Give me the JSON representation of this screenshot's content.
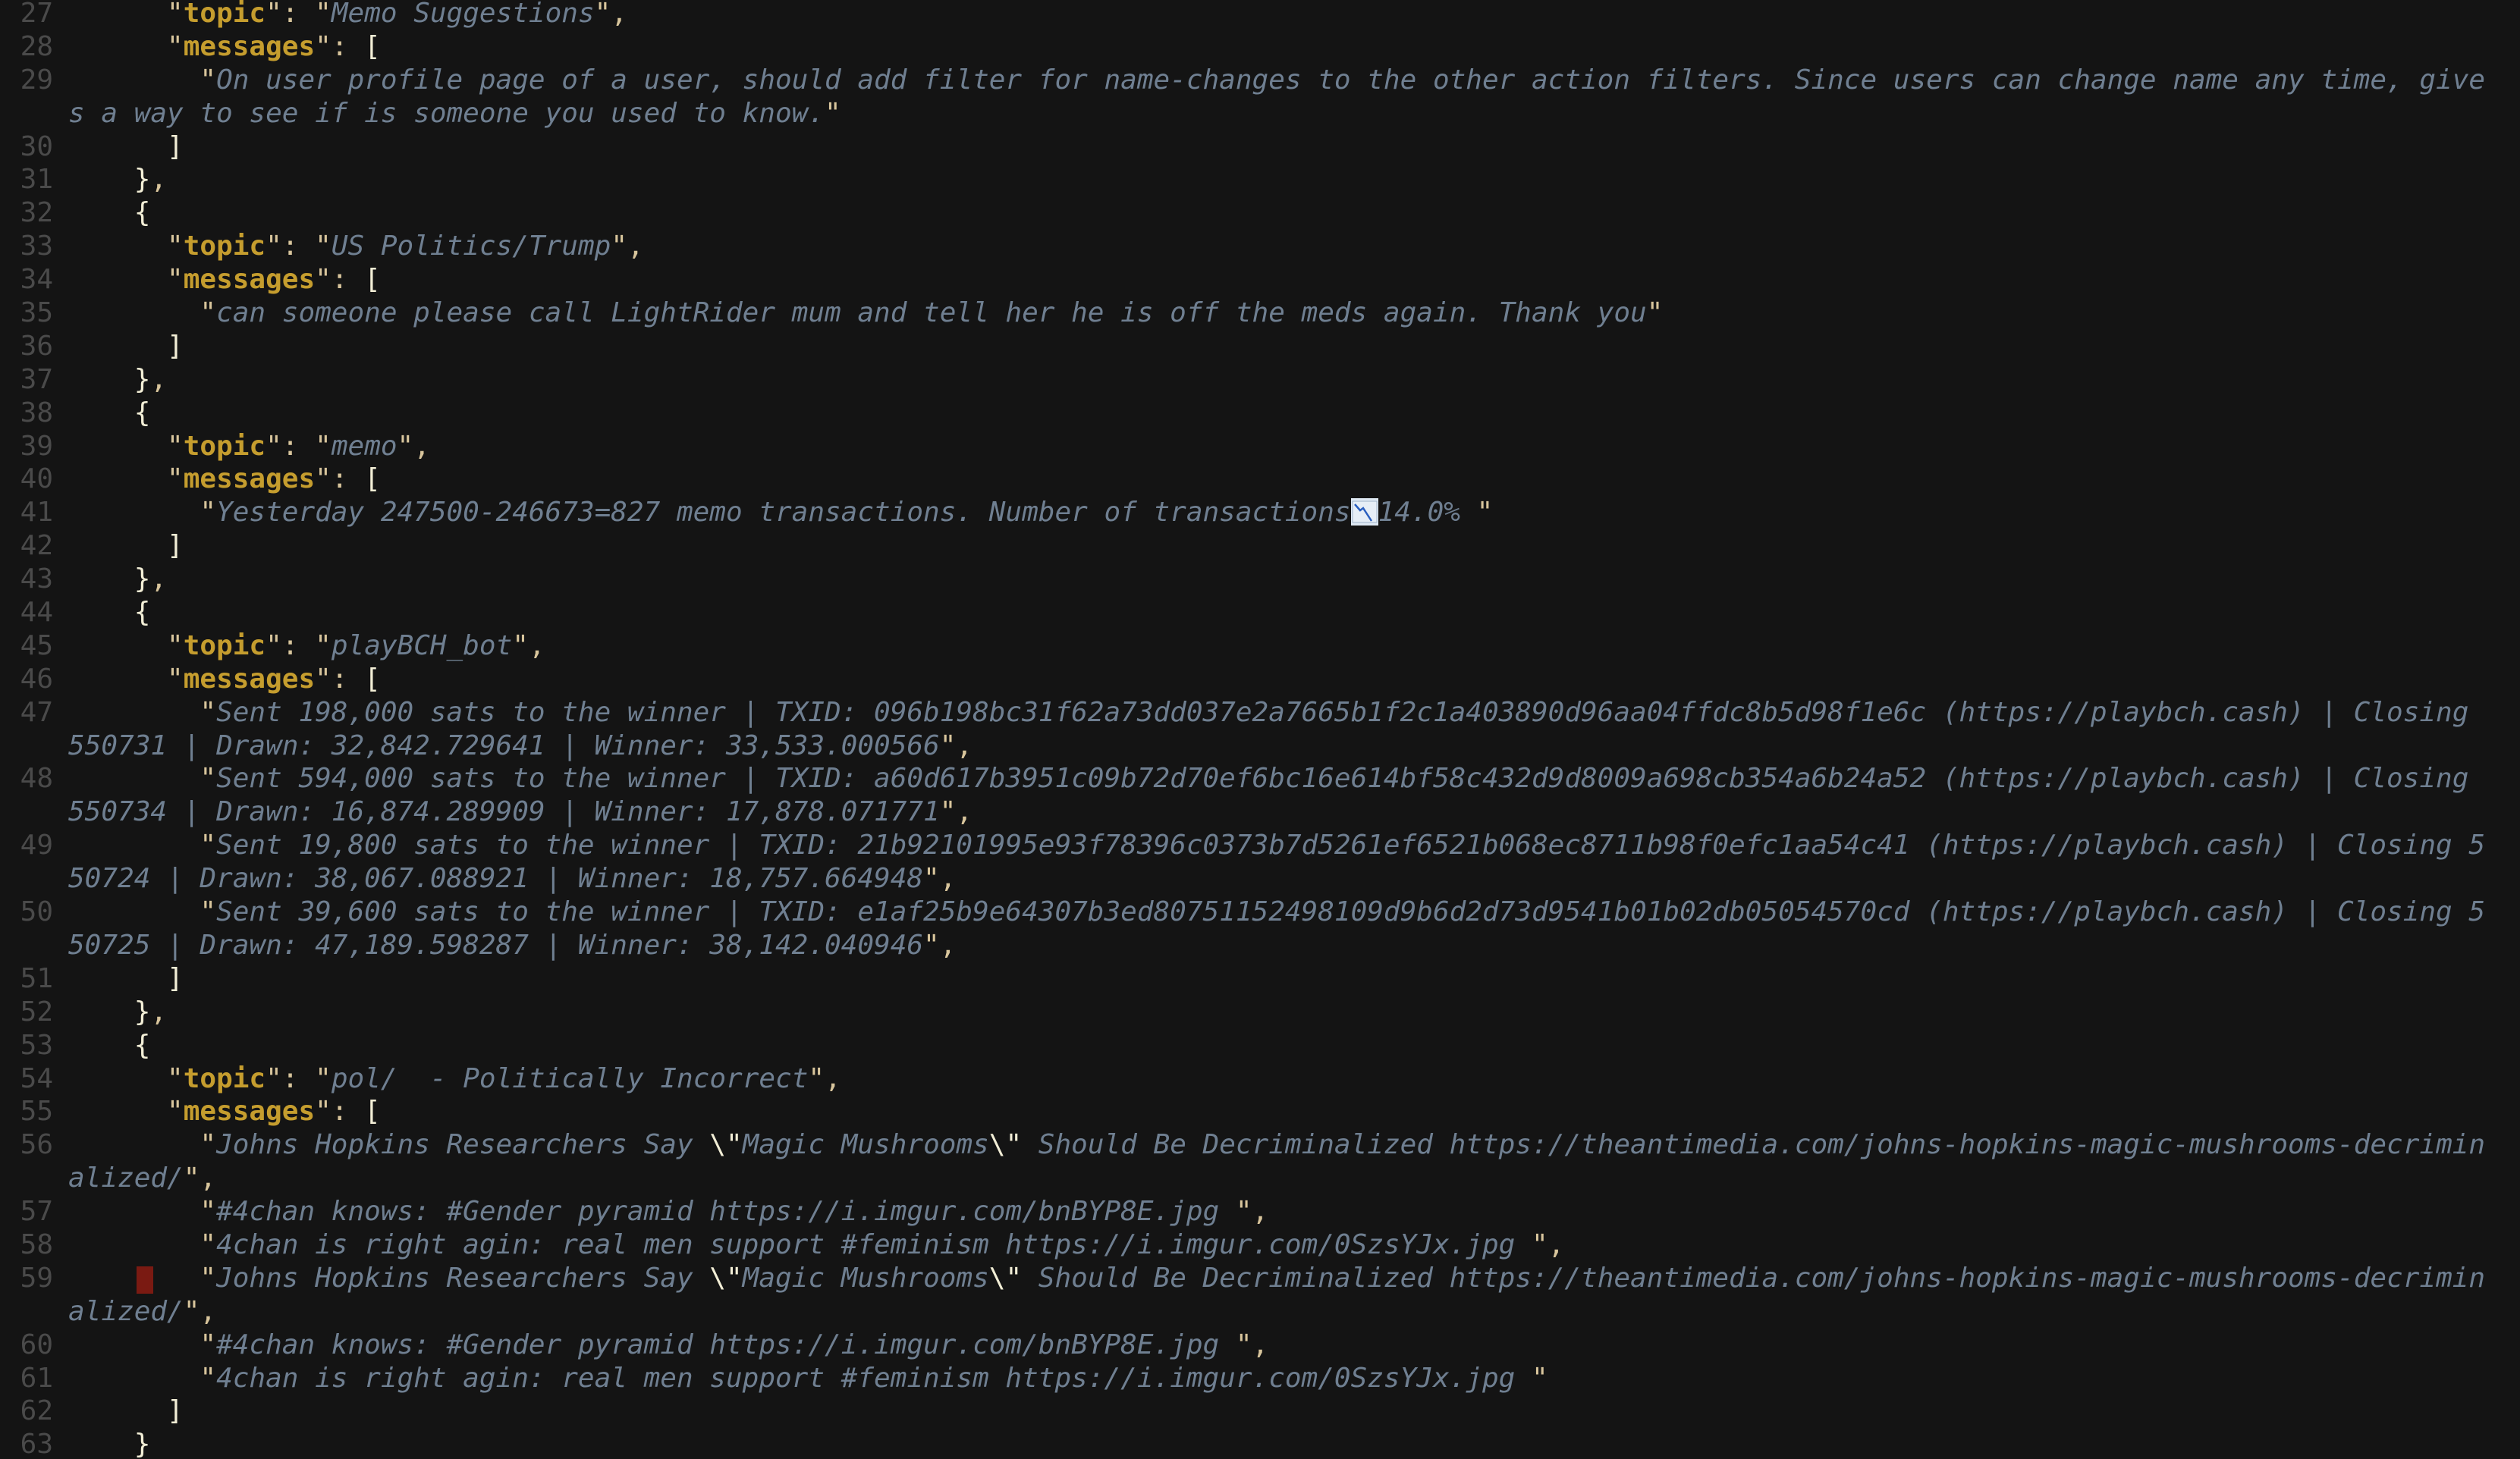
{
  "editor": {
    "language": "json",
    "lines": [
      {
        "n": "27",
        "kind": "kv",
        "indent": 3,
        "key": "topic",
        "value": "Memo Suggestions",
        "trail": ","
      },
      {
        "n": "28",
        "kind": "karr",
        "indent": 3,
        "key": "messages"
      },
      {
        "n": "29",
        "kind": "str",
        "indent": 4,
        "text": "On user profile page of a user, should add filter for name-changes to the other action filters. Since users can change name any time, give",
        "trail": ""
      },
      {
        "n": "",
        "kind": "wrapstr",
        "text": "s a way to see if is someone you used to know.",
        "trail": ""
      },
      {
        "n": "30",
        "kind": "close",
        "indent": 3,
        "text": "]"
      },
      {
        "n": "31",
        "kind": "close",
        "indent": 2,
        "text": "}",
        "trail": ","
      },
      {
        "n": "32",
        "kind": "close",
        "indent": 2,
        "text": "{"
      },
      {
        "n": "33",
        "kind": "kv",
        "indent": 3,
        "key": "topic",
        "value": "US Politics/Trump",
        "trail": ","
      },
      {
        "n": "34",
        "kind": "karr",
        "indent": 3,
        "key": "messages"
      },
      {
        "n": "35",
        "kind": "strfull",
        "indent": 4,
        "text": "can someone please call LightRider mum and tell her he is off the meds again. Thank you",
        "trail": ""
      },
      {
        "n": "36",
        "kind": "close",
        "indent": 3,
        "text": "]"
      },
      {
        "n": "37",
        "kind": "close",
        "indent": 2,
        "text": "}",
        "trail": ","
      },
      {
        "n": "38",
        "kind": "close",
        "indent": 2,
        "text": "{"
      },
      {
        "n": "39",
        "kind": "kv",
        "indent": 3,
        "key": "topic",
        "value": "memo",
        "trail": ","
      },
      {
        "n": "40",
        "kind": "karr",
        "indent": 3,
        "key": "messages"
      },
      {
        "n": "41",
        "kind": "emojistr",
        "indent": 4,
        "before": "Yesterday 247500-246673=827 memo transactions. Number of transactions",
        "emoji": "chart-decreasing",
        "after": "14.0% ",
        "trail": ""
      },
      {
        "n": "42",
        "kind": "close",
        "indent": 3,
        "text": "]"
      },
      {
        "n": "43",
        "kind": "close",
        "indent": 2,
        "text": "}",
        "trail": ","
      },
      {
        "n": "44",
        "kind": "close",
        "indent": 2,
        "text": "{"
      },
      {
        "n": "45",
        "kind": "kv",
        "indent": 3,
        "key": "topic",
        "value": "playBCH_bot",
        "trail": ","
      },
      {
        "n": "46",
        "kind": "karr",
        "indent": 3,
        "key": "messages"
      },
      {
        "n": "47",
        "kind": "str",
        "indent": 4,
        "text": "Sent 198,000 sats to the winner | TXID: 096b198bc31f62a73dd037e2a7665b1f2c1a403890d96aa04ffdc8b5d98f1e6c (https://playbch.cash) | Closing "
      },
      {
        "n": "",
        "kind": "wrapstr",
        "text": "550731 | Drawn: 32,842.729641 | Winner: 33,533.000566",
        "trail": ","
      },
      {
        "n": "48",
        "kind": "str",
        "indent": 4,
        "text": "Sent 594,000 sats to the winner | TXID: a60d617b3951c09b72d70ef6bc16e614bf58c432d9d8009a698cb354a6b24a52 (https://playbch.cash) | Closing "
      },
      {
        "n": "",
        "kind": "wrapstr",
        "text": "550734 | Drawn: 16,874.289909 | Winner: 17,878.071771",
        "trail": ","
      },
      {
        "n": "49",
        "kind": "str",
        "indent": 4,
        "text": "Sent 19,800 sats to the winner | TXID: 21b92101995e93f78396c0373b7d5261ef6521b068ec8711b98f0efc1aa54c41 (https://playbch.cash) | Closing 5"
      },
      {
        "n": "",
        "kind": "wrapstr",
        "text": "50724 | Drawn: 38,067.088921 | Winner: 18,757.664948",
        "trail": ","
      },
      {
        "n": "50",
        "kind": "str",
        "indent": 4,
        "text": "Sent 39,600 sats to the winner | TXID: e1af25b9e64307b3ed80751152498109d9b6d2d73d9541b01b02db05054570cd (https://playbch.cash) | Closing 5"
      },
      {
        "n": "",
        "kind": "wrapstr",
        "text": "50725 | Drawn: 47,189.598287 | Winner: 38,142.040946",
        "trail": ","
      },
      {
        "n": "51",
        "kind": "close",
        "indent": 3,
        "text": "]"
      },
      {
        "n": "52",
        "kind": "close",
        "indent": 2,
        "text": "}",
        "trail": ","
      },
      {
        "n": "53",
        "kind": "close",
        "indent": 2,
        "text": "{"
      },
      {
        "n": "54",
        "kind": "kv",
        "indent": 3,
        "key": "topic",
        "value": "pol/  - Politically Incorrect",
        "trail": ","
      },
      {
        "n": "55",
        "kind": "karr",
        "indent": 3,
        "key": "messages"
      },
      {
        "n": "56",
        "kind": "escstr",
        "indent": 4,
        "pre": "Johns Hopkins Researchers Say ",
        "mid": "Magic Mushrooms",
        "post": " Should Be Decriminalized https://theantimedia.com/johns-hopkins-magic-mushrooms-decrimin"
      },
      {
        "n": "",
        "kind": "wrapstr",
        "text": "alized/",
        "trail": ","
      },
      {
        "n": "57",
        "kind": "strfull",
        "indent": 4,
        "text": "#4chan knows: #Gender pyramid https://i.imgur.com/bnBYP8E.jpg ",
        "trail": ","
      },
      {
        "n": "58",
        "kind": "strfull",
        "indent": 4,
        "text": "4chan is right agin: real men support #feminism https://i.imgur.com/0SzsYJx.jpg ",
        "trail": ","
      },
      {
        "n": "59",
        "kind": "escstr",
        "indent": 4,
        "marker": true,
        "pre": "Johns Hopkins Researchers Say ",
        "mid": "Magic Mushrooms",
        "post": " Should Be Decriminalized https://theantimedia.com/johns-hopkins-magic-mushrooms-decrimin"
      },
      {
        "n": "",
        "kind": "wrapstr",
        "text": "alized/",
        "trail": ","
      },
      {
        "n": "60",
        "kind": "strfull",
        "indent": 4,
        "text": "#4chan knows: #Gender pyramid https://i.imgur.com/bnBYP8E.jpg ",
        "trail": ","
      },
      {
        "n": "61",
        "kind": "strfull",
        "indent": 4,
        "text": "4chan is right agin: real men support #feminism https://i.imgur.com/0SzsYJx.jpg ",
        "trail": ""
      },
      {
        "n": "62",
        "kind": "close",
        "indent": 3,
        "text": "]"
      },
      {
        "n": "63",
        "kind": "close",
        "indent": 2,
        "text": "}"
      }
    ]
  },
  "theme": {
    "background": "#141414",
    "line_number": "#4a4a4a",
    "key": "#c59d2e",
    "punctuation": "#d8c59c",
    "bracket": "#f2eed6",
    "string": "#6f7f91",
    "error_marker": "#7a1a12"
  }
}
